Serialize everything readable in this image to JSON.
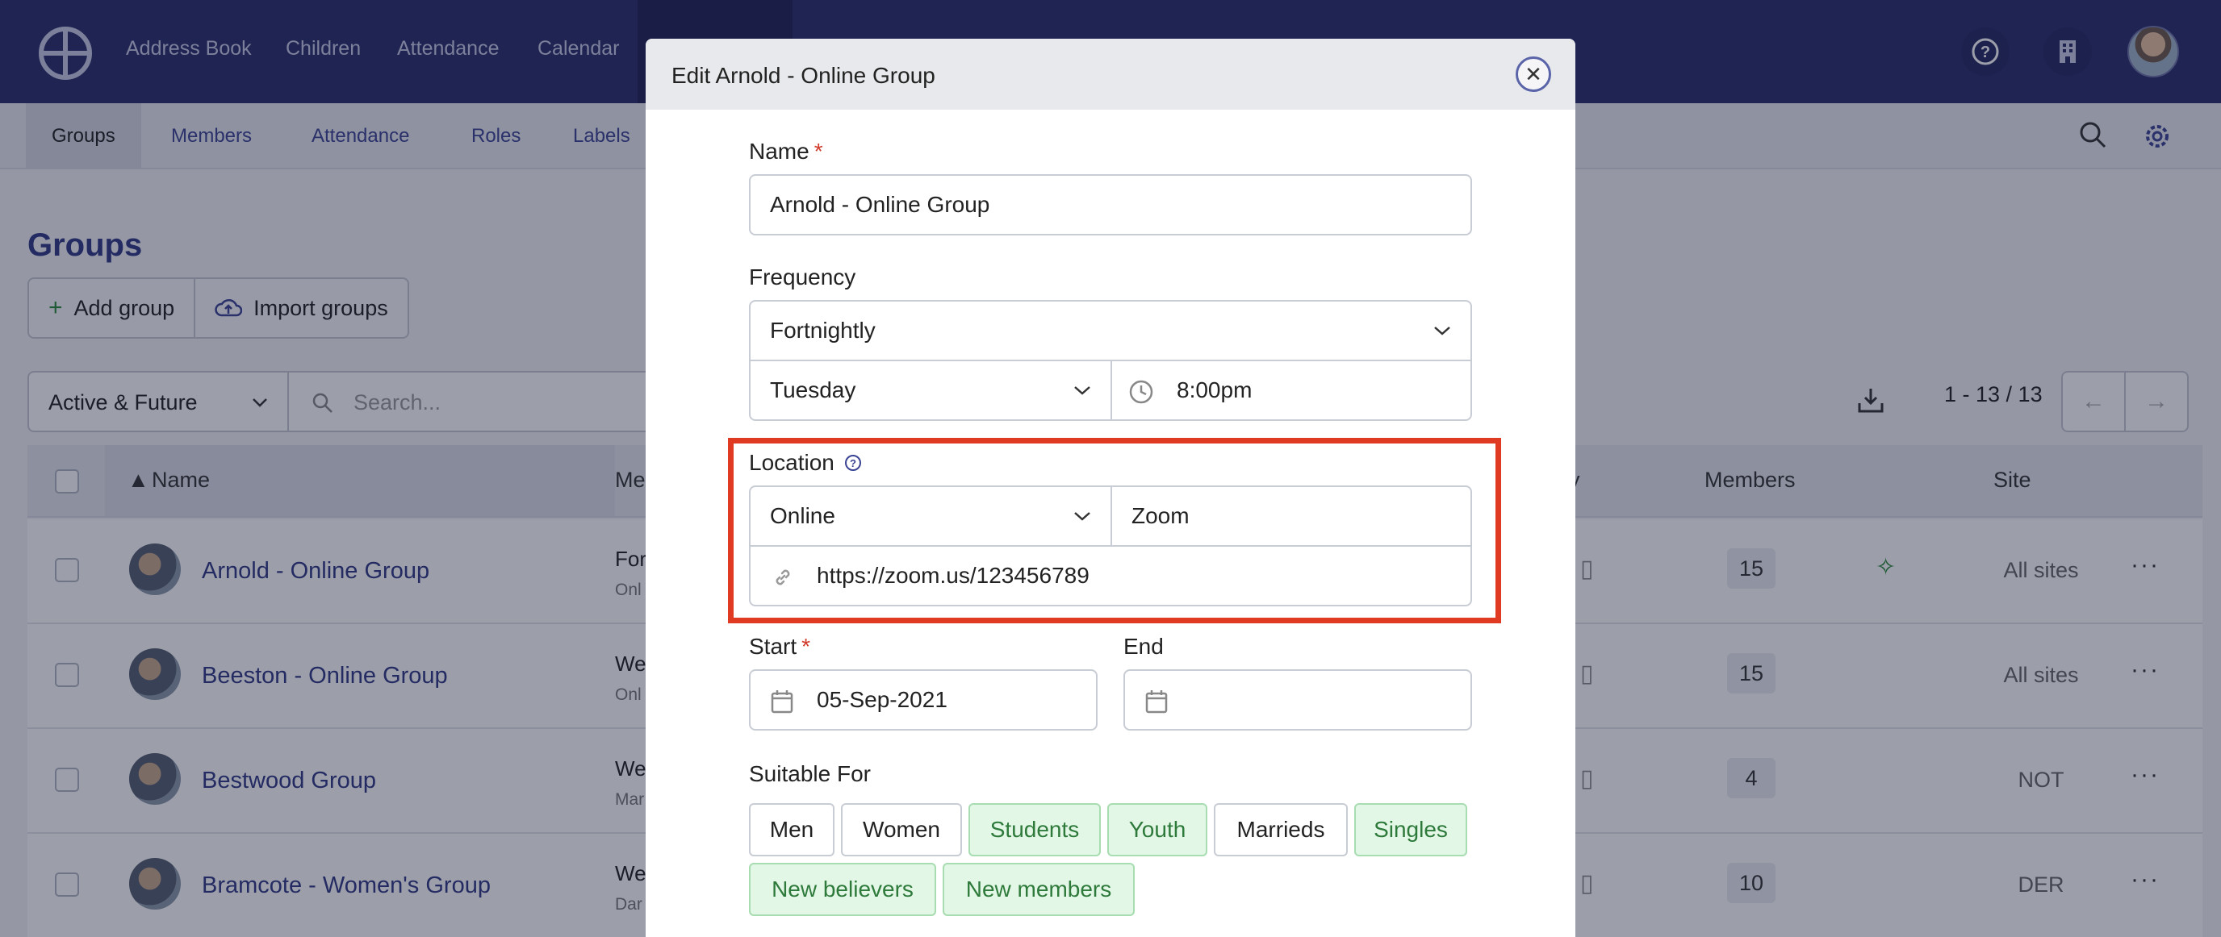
{
  "topnav": {
    "items": [
      "Address Book",
      "Children",
      "Attendance",
      "Calendar"
    ],
    "help_icon": "question-circle-icon",
    "building_icon": "building-icon"
  },
  "subnav": {
    "tabs": [
      "Groups",
      "Members",
      "Attendance",
      "Roles",
      "Labels"
    ]
  },
  "page": {
    "title": "Groups",
    "add_group": "Add group",
    "import_groups": "Import groups",
    "status_filter": "Active & Future",
    "search_placeholder": "Search...",
    "pager_text": "1 - 13 / 13"
  },
  "table": {
    "headers": {
      "name": "Name",
      "meeting": "Me",
      "frequency_tail": "y",
      "members": "Members",
      "site": "Site"
    },
    "rows": [
      {
        "name": "Arnold - Online Group",
        "freq": "For",
        "sub": "Onl",
        "count": "15",
        "site": "All sites"
      },
      {
        "name": "Beeston - Online Group",
        "freq": "We",
        "sub": "Onl",
        "count": "15",
        "site": "All sites"
      },
      {
        "name": "Bestwood Group",
        "freq": "We",
        "sub": "Mar",
        "count": "4",
        "site": "NOT"
      },
      {
        "name": "Bramcote - Women's Group",
        "freq": "We",
        "sub": "Dar",
        "count": "10",
        "site": "DER"
      }
    ]
  },
  "modal": {
    "title": "Edit Arnold - Online Group",
    "name_label": "Name",
    "required_mark": "*",
    "name_value": "Arnold - Online Group",
    "frequency_label": "Frequency",
    "frequency_value": "Fortnightly",
    "day_value": "Tuesday",
    "time_value": "8:00pm",
    "location_label": "Location",
    "location_type": "Online",
    "location_platform": "Zoom",
    "location_url": "https://zoom.us/123456789",
    "start_label": "Start",
    "start_value": "05-Sep-2021",
    "end_label": "End",
    "end_value": "",
    "suitable_label": "Suitable For",
    "suitable_tags": [
      {
        "label": "Men",
        "selected": false
      },
      {
        "label": "Women",
        "selected": false
      },
      {
        "label": "Students",
        "selected": true
      },
      {
        "label": "Youth",
        "selected": true
      },
      {
        "label": "Marrieds",
        "selected": false
      },
      {
        "label": "Singles",
        "selected": true
      },
      {
        "label": "New believers",
        "selected": true
      },
      {
        "label": "New members",
        "selected": true
      }
    ]
  },
  "colors": {
    "nav_bg": "#282d6b",
    "accent": "#2f3a86",
    "highlight": "#e03a22",
    "tag_selected_bg": "#e3f7e6"
  }
}
